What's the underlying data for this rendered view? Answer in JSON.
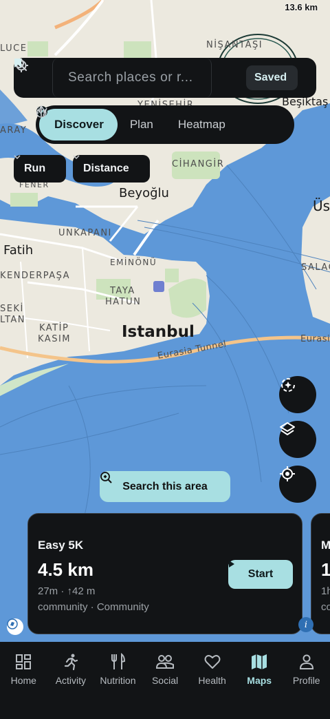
{
  "map": {
    "scale_label": "13.6 km",
    "labels": {
      "luce": "LUCE",
      "nisantasi": "NİŞANTAŞI",
      "besiktas": "Beşiktaş",
      "yenisehir": "YENİŞEHİR",
      "aray": "ARAY",
      "cihangir": "CİHANGİR",
      "fener": "FENER",
      "beyoglu": "Beyoğlu",
      "us": "Üs",
      "unkapani": "UNKAPANI",
      "fatih": "Fatih",
      "eminonu": "EMİNÖNÜ",
      "salac": "SALAC",
      "kenderpasa": "KENDERPAŞA",
      "taya": "TAYA",
      "hatun": "HATUN",
      "seki": "SEKİ",
      "ltan": "LTAN",
      "katip": "KATİP",
      "kasim": "KASIM",
      "istanbul": "Istanbul",
      "eurasia": "Eurasia",
      "eurasia_tunnel": "Eurasia Tunnel"
    }
  },
  "search": {
    "placeholder": "Search places or r...",
    "value": "",
    "saved_label": "Saved"
  },
  "modes": [
    {
      "label": "Discover",
      "icon": "compass-icon",
      "active": true
    },
    {
      "label": "Plan",
      "icon": "route-plan-icon",
      "active": false
    },
    {
      "label": "Heatmap",
      "icon": "flame-icon",
      "active": false
    }
  ],
  "filters": [
    {
      "label": "Run"
    },
    {
      "label": "Distance"
    }
  ],
  "search_area_label": "Search this area",
  "routes": [
    {
      "title": "Easy 5K",
      "distance": "4.5 km",
      "meta": "27m · ↑42 m",
      "source": "community · Community",
      "start_label": "Start"
    },
    {
      "title": "M",
      "distance": "1",
      "meta": "1h",
      "source": "co"
    }
  ],
  "nav": [
    {
      "label": "Home",
      "icon": "home-grid-icon",
      "active": false
    },
    {
      "label": "Activity",
      "icon": "runner-icon",
      "active": false
    },
    {
      "label": "Nutrition",
      "icon": "fork-knife-icon",
      "active": false
    },
    {
      "label": "Social",
      "icon": "people-icon",
      "active": false
    },
    {
      "label": "Health",
      "icon": "heart-icon",
      "active": false
    },
    {
      "label": "Maps",
      "icon": "map-icon",
      "active": true
    },
    {
      "label": "Profile",
      "icon": "person-icon",
      "active": false
    }
  ],
  "colors": {
    "accent": "#a8dfe2",
    "panel": "#121416",
    "water": "#5e98d8",
    "land": "#ece9df"
  }
}
